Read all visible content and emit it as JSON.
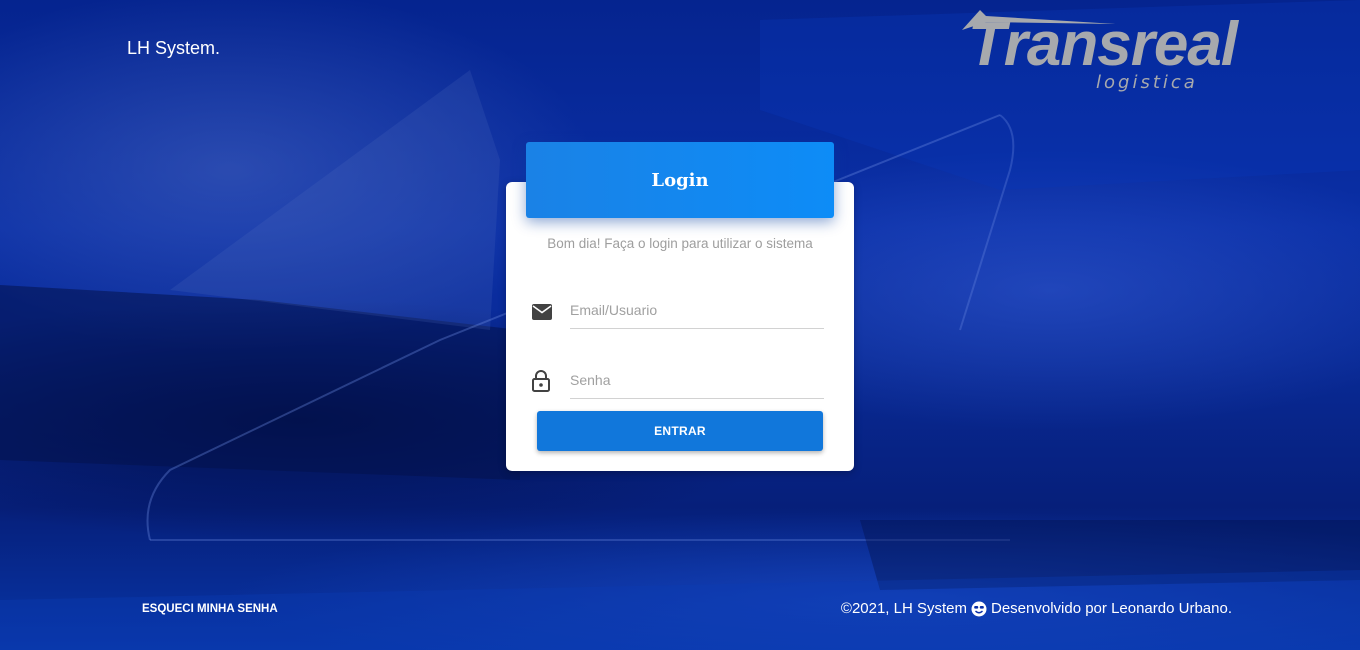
{
  "brand": {
    "name": "LH System."
  },
  "logo": {
    "main": "Transreal",
    "sub": "logistica"
  },
  "card": {
    "title": "Login",
    "subtitle": "Bom dia! Faça o login para utilizar o sistema",
    "email": {
      "placeholder": "Email/Usuario",
      "value": "",
      "icon": "mail-icon"
    },
    "password": {
      "placeholder": "Senha",
      "value": "",
      "icon": "lock-icon"
    },
    "submit_label": "ENTRAR"
  },
  "footer": {
    "forgot_label": "ESQUECI MINHA SENHA",
    "copyright": "©2021, LH System",
    "credit": "Desenvolvido por Leonardo Urbano.",
    "icon": "smile-icon"
  },
  "colors": {
    "background": "#0a2fa6",
    "header_accent": "#1a82e6",
    "button": "#1177db",
    "logo": "#a7a9ad"
  }
}
